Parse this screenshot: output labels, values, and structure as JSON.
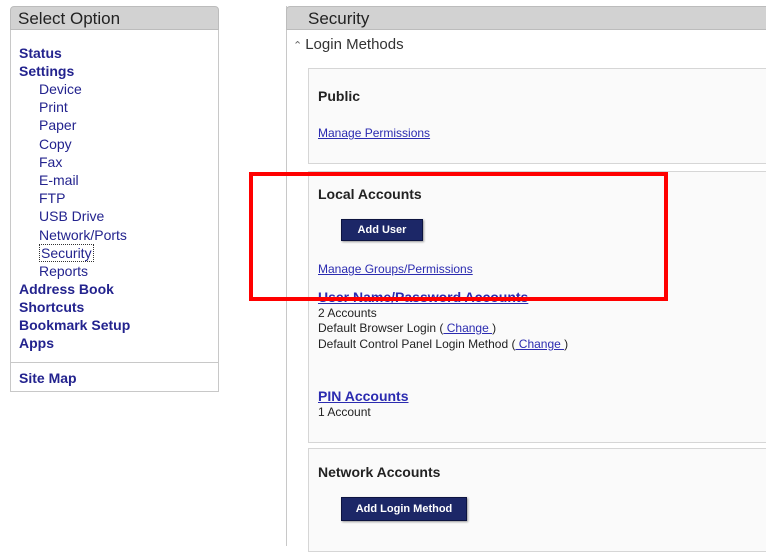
{
  "sidebar": {
    "title": "Select Option",
    "items": [
      {
        "label": "Status",
        "level": "top"
      },
      {
        "label": "Settings",
        "level": "top"
      },
      {
        "label": "Device",
        "level": "sub"
      },
      {
        "label": "Print",
        "level": "sub"
      },
      {
        "label": "Paper",
        "level": "sub"
      },
      {
        "label": "Copy",
        "level": "sub"
      },
      {
        "label": "Fax",
        "level": "sub"
      },
      {
        "label": "E-mail",
        "level": "sub"
      },
      {
        "label": "FTP",
        "level": "sub"
      },
      {
        "label": "USB Drive",
        "level": "sub"
      },
      {
        "label": "Network/Ports",
        "level": "sub"
      },
      {
        "label": "Security",
        "level": "sub",
        "selected": true
      },
      {
        "label": "Reports",
        "level": "sub"
      },
      {
        "label": "Address Book",
        "level": "top"
      },
      {
        "label": "Shortcuts",
        "level": "top"
      },
      {
        "label": "Bookmark Setup",
        "level": "top"
      },
      {
        "label": "Apps",
        "level": "top"
      }
    ],
    "site_map": "Site Map"
  },
  "main": {
    "title": "Security",
    "section_label": "Login Methods",
    "public": {
      "title": "Public",
      "manage_link": "Manage Permissions"
    },
    "local_accounts": {
      "title": "Local Accounts",
      "add_user_button": "Add User",
      "manage_link": "Manage Groups/Permissions",
      "user_pw_title": "User Name/Password Accounts",
      "user_pw_count": "2 Accounts",
      "browser_login_label": "Default Browser Login (",
      "browser_login_change": " Change ",
      "close_paren": ")",
      "control_panel_label": "Default Control Panel Login Method (",
      "control_panel_change": " Change ",
      "pin_title": "PIN Accounts",
      "pin_count": "1 Account"
    },
    "network_accounts": {
      "title": "Network Accounts",
      "add_button": "Add Login Method"
    }
  },
  "colors": {
    "highlight": "#ff0000",
    "nav_link": "#23238e",
    "button_bg": "#1c2767"
  }
}
